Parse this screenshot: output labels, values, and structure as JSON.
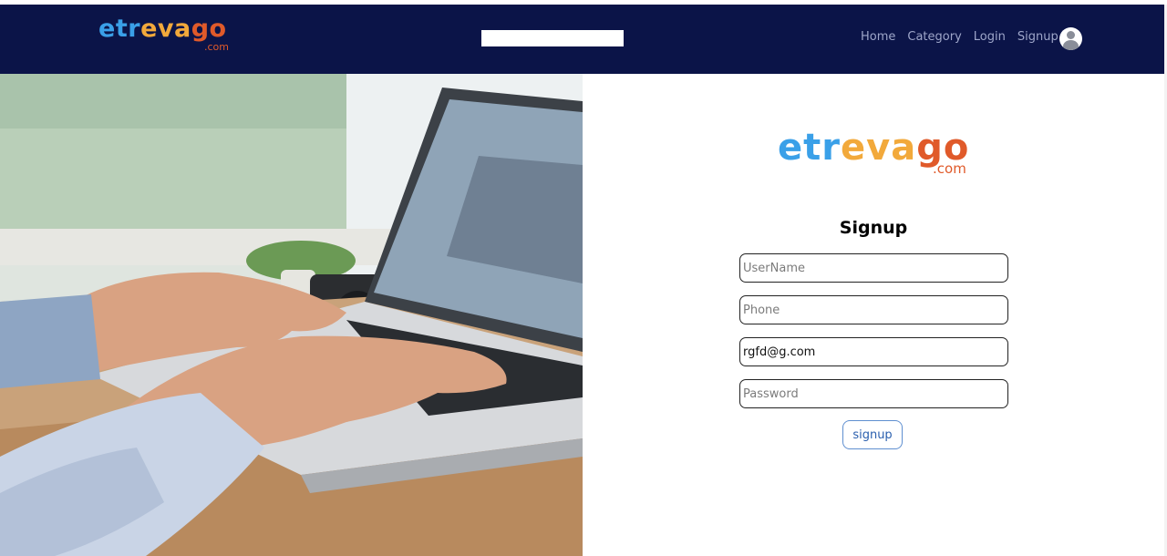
{
  "brand": {
    "letters": [
      {
        "ch": "e",
        "color": "#3aa0e8"
      },
      {
        "ch": "t",
        "color": "#3aa0e8"
      },
      {
        "ch": "r",
        "color": "#3aa0e8"
      },
      {
        "ch": "e",
        "color": "#f2a93b"
      },
      {
        "ch": "v",
        "color": "#f2a93b"
      },
      {
        "ch": "a",
        "color": "#f2a93b"
      },
      {
        "ch": "g",
        "color": "#e05a2a"
      },
      {
        "ch": "o",
        "color": "#e05a2a"
      }
    ],
    "suffix": ".com",
    "suffix_color": "#e05a2a",
    "big_suffix_color": "#f2a93b"
  },
  "navbar": {
    "search": {
      "value": "",
      "placeholder": ""
    },
    "links": [
      {
        "label": "Home",
        "active": true
      },
      {
        "label": "Category",
        "active": false
      },
      {
        "label": "Login",
        "active": false
      },
      {
        "label": "Signup",
        "active": false
      }
    ],
    "avatar_icon": "user-avatar-icon"
  },
  "hero": {
    "image": "person-typing-on-laptop-photo"
  },
  "signup_form": {
    "title": "Signup",
    "fields": {
      "username": {
        "value": "",
        "placeholder": "UserName"
      },
      "phone": {
        "value": "",
        "placeholder": "Phone"
      },
      "email": {
        "value": "rgfd@g.com",
        "placeholder": ""
      },
      "password": {
        "value": "",
        "placeholder": "Password"
      }
    },
    "submit_label": "signup"
  },
  "colors": {
    "navbar_bg": "#0b1448",
    "nav_link": "#9ea6c9",
    "nav_link_active": "#ffffff",
    "button_border": "#5f8fd0"
  }
}
